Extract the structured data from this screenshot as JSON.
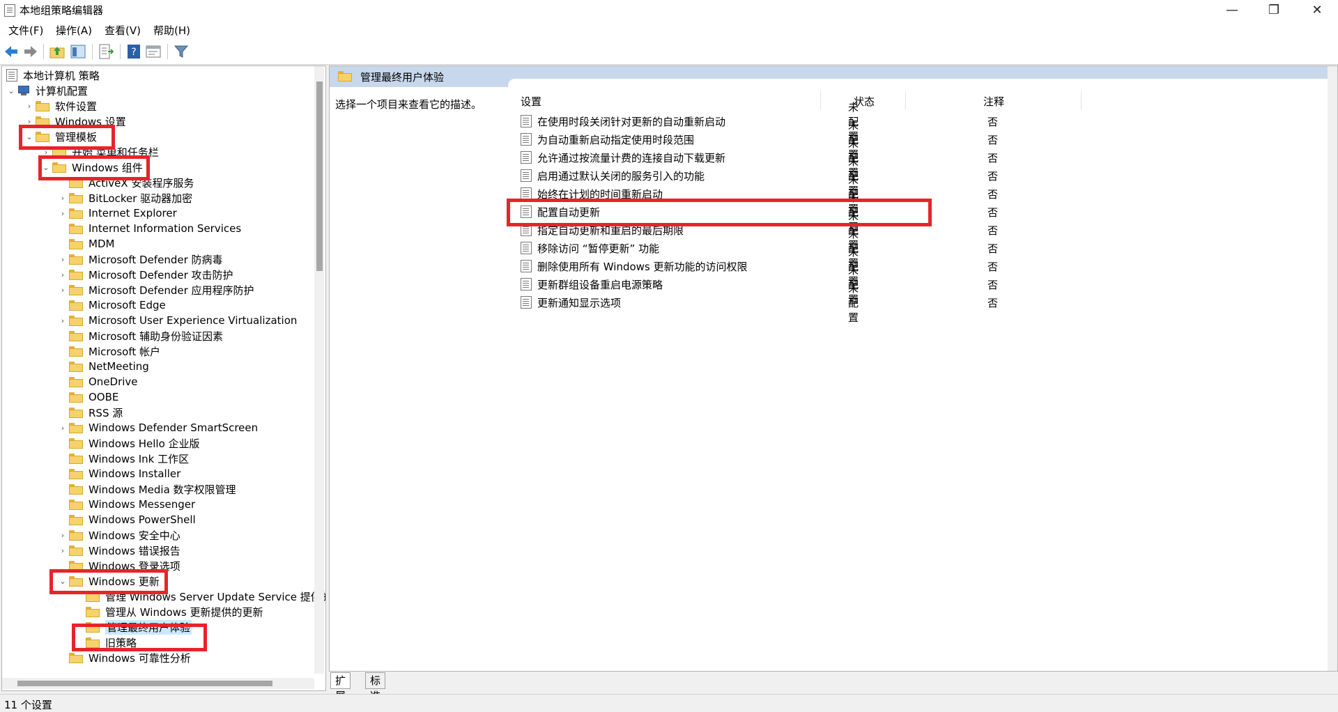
{
  "window": {
    "title": "本地组策略编辑器",
    "minimize": "—",
    "maximize": "❐",
    "close": "✕"
  },
  "menu": [
    "文件(F)",
    "操作(A)",
    "查看(V)",
    "帮助(H)"
  ],
  "tree": {
    "root": "本地计算机 策略",
    "computer_config": "计算机配置",
    "software": "软件设置",
    "windows_settings": "Windows 设置",
    "admin_templates": "管理模板",
    "start_menu": "开始 菜单和任务栏",
    "windows_components": "Windows 组件",
    "components": [
      "ActiveX 安装程序服务",
      "BitLocker 驱动器加密",
      "Internet Explorer",
      "Internet Information Services",
      "MDM",
      "Microsoft Defender 防病毒",
      "Microsoft Defender 攻击防护",
      "Microsoft Defender 应用程序防护",
      "Microsoft Edge",
      "Microsoft User Experience Virtualization",
      "Microsoft 辅助身份验证因素",
      "Microsoft 帐户",
      "NetMeeting",
      "OneDrive",
      "OOBE",
      "RSS 源",
      "Windows Defender SmartScreen",
      "Windows Hello 企业版",
      "Windows Ink 工作区",
      "Windows Installer",
      "Windows Media 数字权限管理",
      "Windows Messenger",
      "Windows PowerShell",
      "Windows 安全中心",
      "Windows 错误报告",
      "Windows 登录选项"
    ],
    "windows_update": "Windows 更新",
    "wu_children": [
      "管理 Windows Server Update Service 提供的",
      "管理从 Windows 更新提供的更新",
      "管理最终用户体验",
      "旧策略"
    ],
    "reliability": "Windows 可靠性分析"
  },
  "right": {
    "header": "管理最终用户体验",
    "description": "选择一个项目来查看它的描述。",
    "columns": {
      "setting": "设置",
      "state": "状态",
      "comment": "注释"
    },
    "rows": [
      {
        "name": "在使用时段关闭针对更新的自动重新启动",
        "state": "未配置",
        "comment": "否"
      },
      {
        "name": "为自动重新启动指定使用时段范围",
        "state": "未配置",
        "comment": "否"
      },
      {
        "name": "允许通过按流量计费的连接自动下载更新",
        "state": "未配置",
        "comment": "否"
      },
      {
        "name": "启用通过默认关闭的服务引入的功能",
        "state": "未配置",
        "comment": "否"
      },
      {
        "name": "始终在计划的时间重新启动",
        "state": "未配置",
        "comment": "否"
      },
      {
        "name": "配置自动更新",
        "state": "未配置",
        "comment": "否"
      },
      {
        "name": "指定自动更新和重启的最后期限",
        "state": "未配置",
        "comment": "否"
      },
      {
        "name": "移除访问 “暂停更新” 功能",
        "state": "未配置",
        "comment": "否"
      },
      {
        "name": "删除使用所有 Windows 更新功能的访问权限",
        "state": "未配置",
        "comment": "否"
      },
      {
        "name": "更新群组设备重启电源策略",
        "state": "未配置",
        "comment": "否"
      },
      {
        "name": "更新通知显示选项",
        "state": "未配置",
        "comment": "否"
      }
    ]
  },
  "tabs": [
    "扩展",
    "标准"
  ],
  "status": "11 个设置",
  "colors": {
    "highlight": "#e8232b",
    "header_bg": "#c7d8ec",
    "selection": "#cce8ff"
  }
}
